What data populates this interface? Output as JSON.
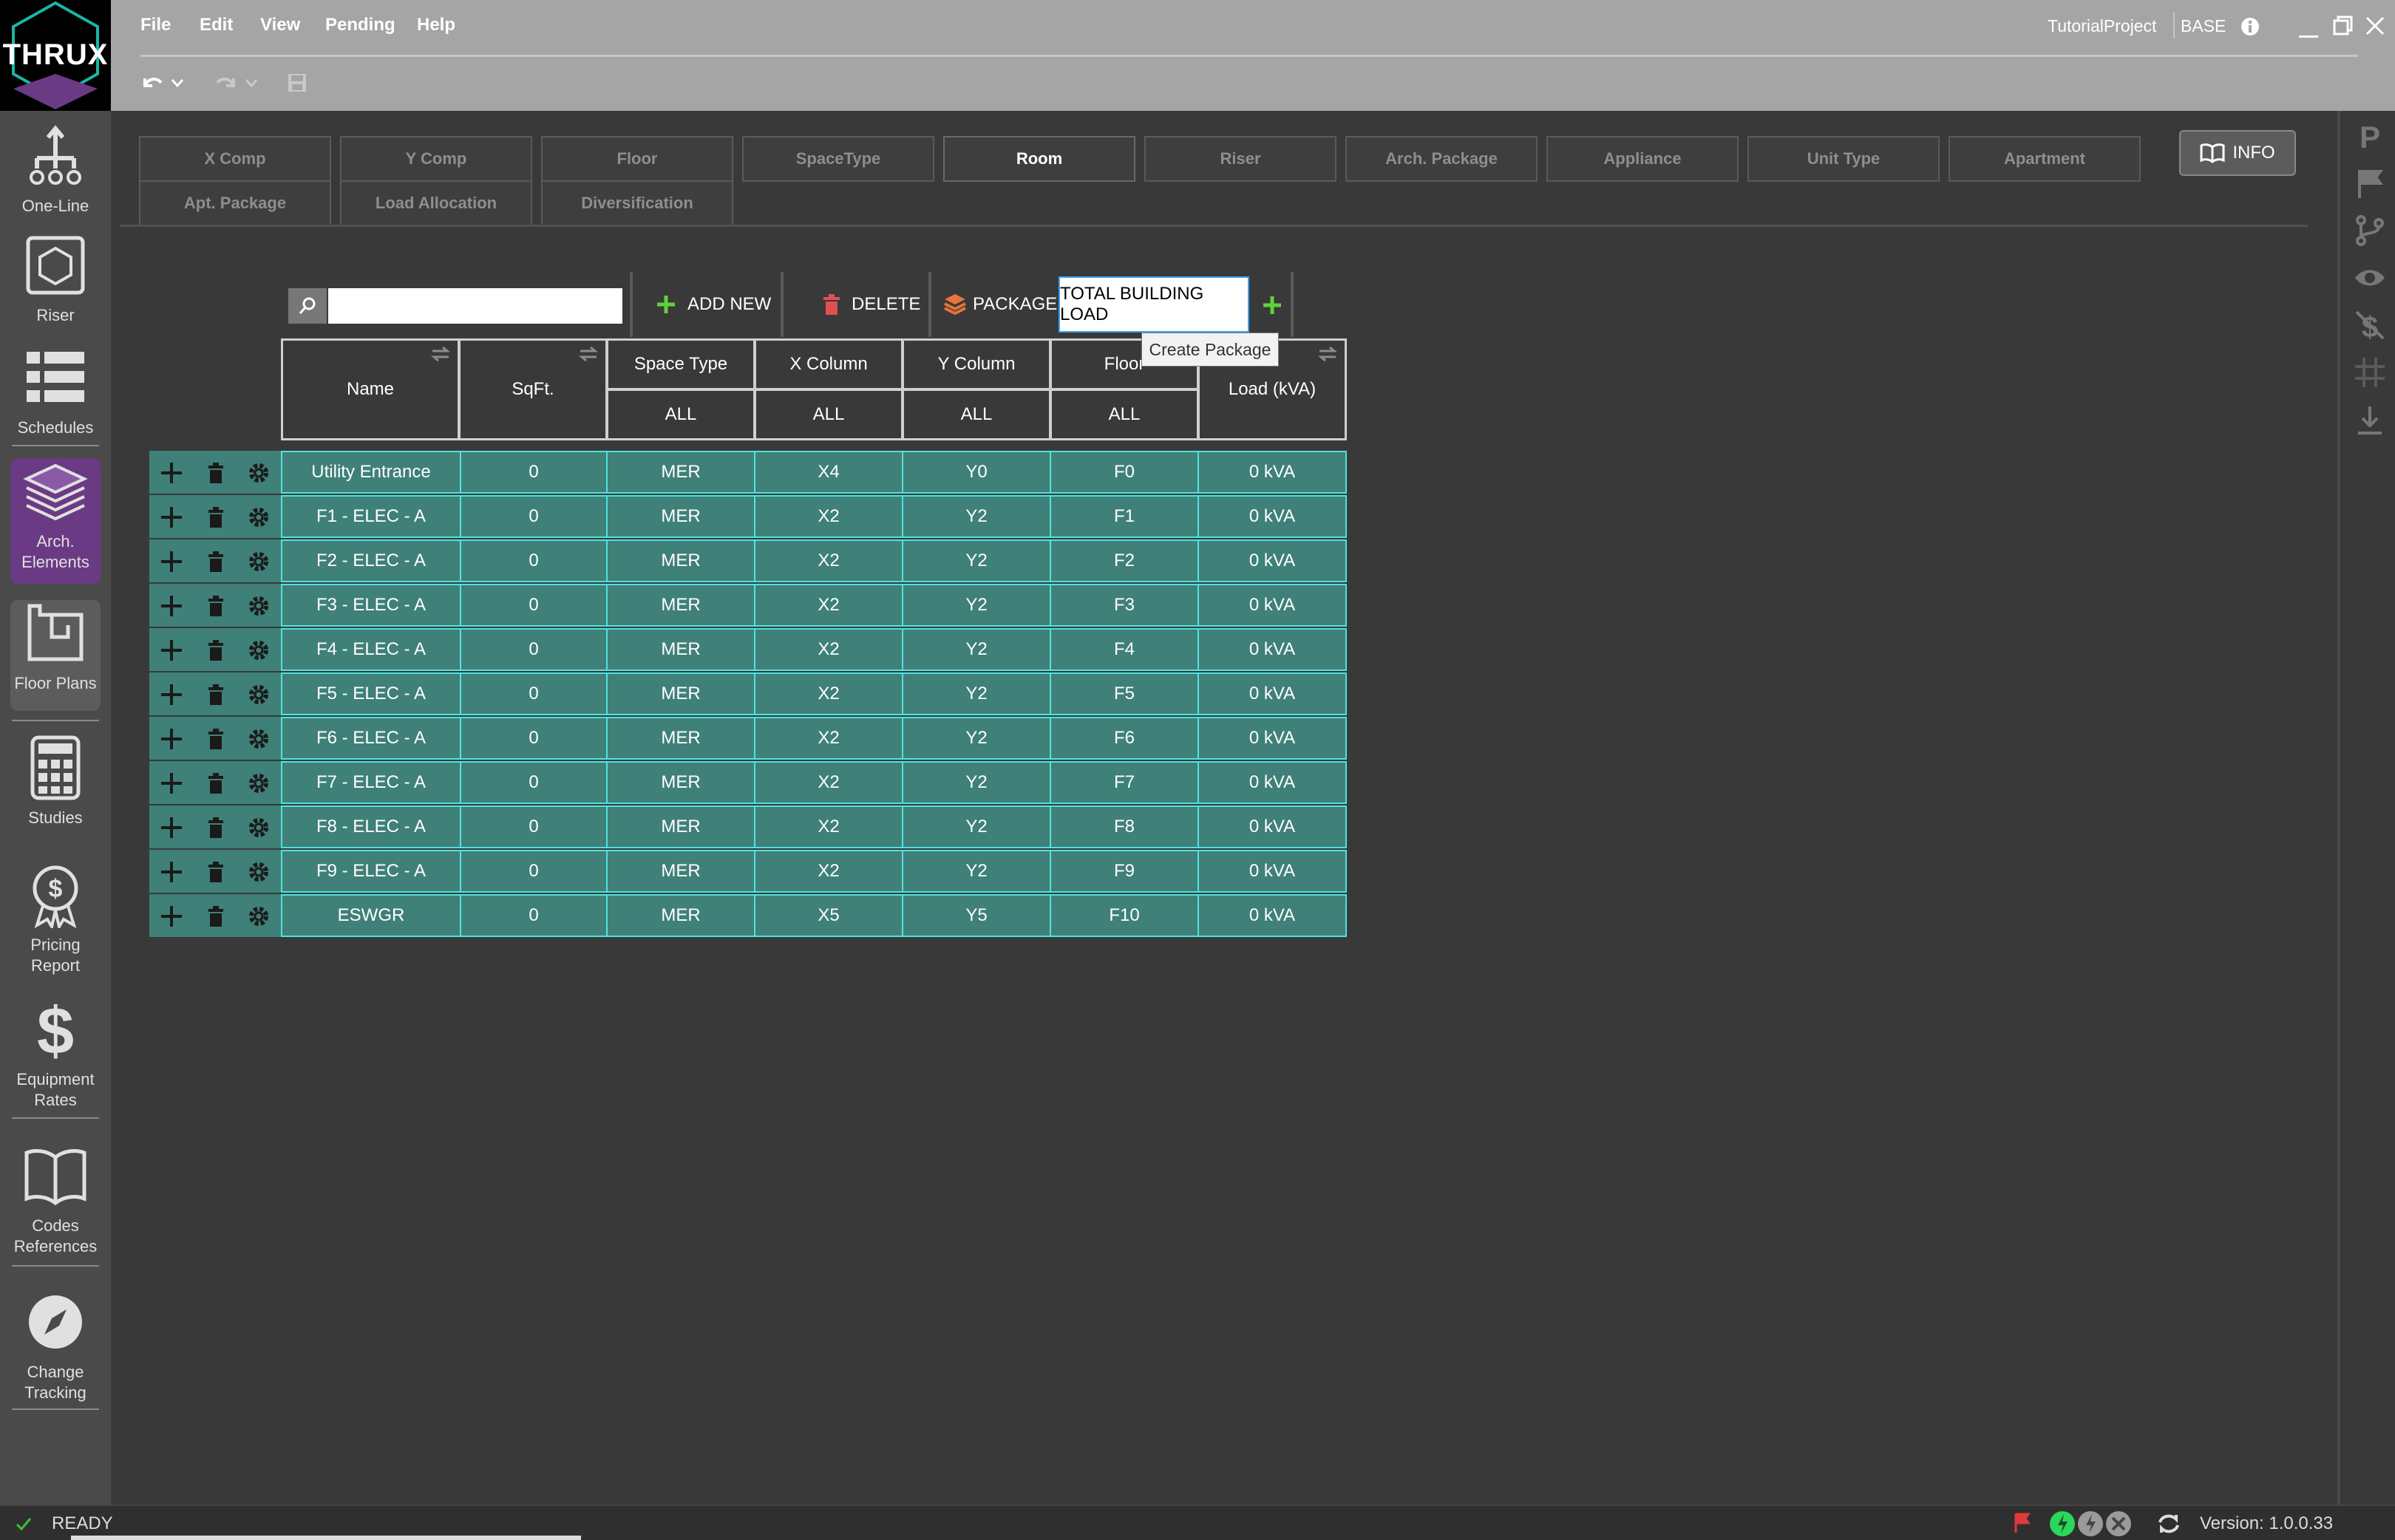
{
  "app": {
    "logo_text": "THRUX"
  },
  "menu": [
    "File",
    "Edit",
    "View",
    "Pending",
    "Help"
  ],
  "header": {
    "project": "TutorialProject",
    "scheme": "BASE"
  },
  "sidebar": {
    "items": [
      {
        "label": "One-Line"
      },
      {
        "label": "Riser"
      },
      {
        "label": "Schedules"
      },
      {
        "label": "Arch. Elements"
      },
      {
        "label": "Floor Plans"
      },
      {
        "label": "Studies"
      },
      {
        "label": "Pricing Report"
      },
      {
        "label": "Equipment Rates"
      },
      {
        "label": "Codes References"
      },
      {
        "label": "Change Tracking"
      }
    ],
    "active": "Arch. Elements"
  },
  "tabs": {
    "row1": [
      "X Comp",
      "Y Comp",
      "Floor",
      "SpaceType",
      "Room",
      "Riser",
      "Arch. Package",
      "Appliance",
      "Unit Type",
      "Apartment"
    ],
    "row2": [
      "Apt. Package",
      "Load Allocation",
      "Diversification"
    ],
    "active": "Room"
  },
  "info_button": {
    "label": "INFO"
  },
  "toolbar": {
    "search_placeholder": "",
    "add_new": "ADD NEW",
    "delete": "DELETE",
    "package": "PACKAGE",
    "package_value": "TOTAL BUILDING LOAD",
    "tooltip": "Create Package"
  },
  "table": {
    "headers": {
      "name": "Name",
      "sqft": "SqFt.",
      "space_type": "Space Type",
      "x_column": "X Column",
      "y_column": "Y Column",
      "floor": "Floor",
      "load": "Load (kVA)"
    },
    "filters": {
      "space_type": "ALL",
      "x_column": "ALL",
      "y_column": "ALL",
      "floor": "ALL"
    },
    "rows": [
      {
        "name": "Utility Entrance",
        "sqft": "0",
        "space_type": "MER",
        "x": "X4",
        "y": "Y0",
        "floor": "F0",
        "load": "0 kVA"
      },
      {
        "name": "F1 - ELEC - A",
        "sqft": "0",
        "space_type": "MER",
        "x": "X2",
        "y": "Y2",
        "floor": "F1",
        "load": "0 kVA"
      },
      {
        "name": "F2 - ELEC - A",
        "sqft": "0",
        "space_type": "MER",
        "x": "X2",
        "y": "Y2",
        "floor": "F2",
        "load": "0 kVA"
      },
      {
        "name": "F3 - ELEC - A",
        "sqft": "0",
        "space_type": "MER",
        "x": "X2",
        "y": "Y2",
        "floor": "F3",
        "load": "0 kVA"
      },
      {
        "name": "F4 - ELEC - A",
        "sqft": "0",
        "space_type": "MER",
        "x": "X2",
        "y": "Y2",
        "floor": "F4",
        "load": "0 kVA"
      },
      {
        "name": "F5 - ELEC - A",
        "sqft": "0",
        "space_type": "MER",
        "x": "X2",
        "y": "Y2",
        "floor": "F5",
        "load": "0 kVA"
      },
      {
        "name": "F6 - ELEC - A",
        "sqft": "0",
        "space_type": "MER",
        "x": "X2",
        "y": "Y2",
        "floor": "F6",
        "load": "0 kVA"
      },
      {
        "name": "F7 - ELEC - A",
        "sqft": "0",
        "space_type": "MER",
        "x": "X2",
        "y": "Y2",
        "floor": "F7",
        "load": "0 kVA"
      },
      {
        "name": "F8 - ELEC - A",
        "sqft": "0",
        "space_type": "MER",
        "x": "X2",
        "y": "Y2",
        "floor": "F8",
        "load": "0 kVA"
      },
      {
        "name": "F9 - ELEC - A",
        "sqft": "0",
        "space_type": "MER",
        "x": "X2",
        "y": "Y2",
        "floor": "F9",
        "load": "0 kVA"
      },
      {
        "name": "ESWGR",
        "sqft": "0",
        "space_type": "MER",
        "x": "X5",
        "y": "Y5",
        "floor": "F10",
        "load": "0 kVA"
      }
    ]
  },
  "status": {
    "text": "READY",
    "version": "Version: 1.0.0.33"
  },
  "colors": {
    "accent": "#6b3a84",
    "row_bg": "#3f8078",
    "row_border": "#50e3e0",
    "add_green": "#5ed33a",
    "delete_red": "#e05050"
  }
}
